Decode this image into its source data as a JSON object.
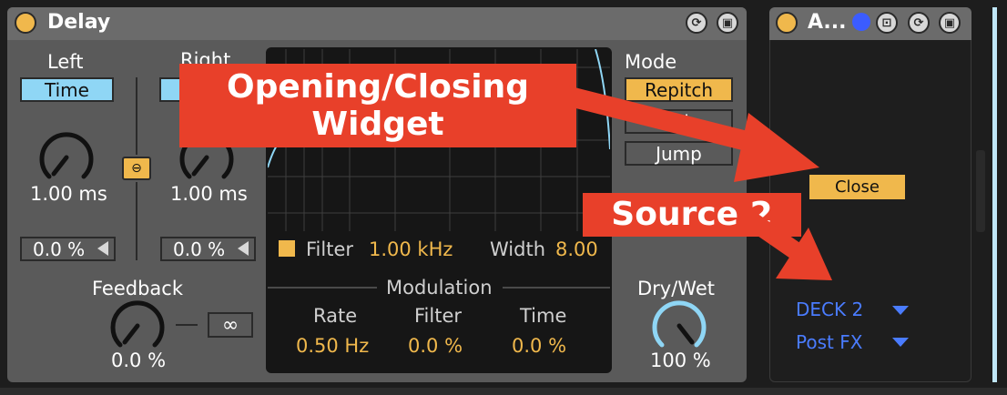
{
  "delay": {
    "title": "Delay",
    "left": {
      "heading": "Left",
      "mode": "Time",
      "knob_value": "1.00 ms",
      "offset": "0.0 %"
    },
    "right": {
      "heading": "Right",
      "knob_value": "1.00 ms",
      "offset": "0.0 %"
    },
    "feedback": {
      "label": "Feedback",
      "value": "0.0 %",
      "freeze_icon": "infinity-icon"
    },
    "filter": {
      "label": "Filter",
      "freq": "1.00 kHz",
      "width_label": "Width",
      "width_value": "8.00"
    },
    "modulation": {
      "heading": "Modulation",
      "rate_label": "Rate",
      "rate_value": "0.50 Hz",
      "filter_label": "Filter",
      "filter_value": "0.0 %",
      "time_label": "Time",
      "time_value": "0.0 %"
    },
    "mode": {
      "heading": "Mode",
      "options": [
        "Repitch",
        "Fade",
        "Jump"
      ],
      "selected": "Repitch"
    },
    "drywet": {
      "label": "Dry/Wet",
      "value": "100 %",
      "level": 1.0
    }
  },
  "device2": {
    "title": "A...",
    "close_label": "Close",
    "source": "DECK 2",
    "tap": "Post FX"
  },
  "annotations": {
    "opening": "Opening/Closing Widget",
    "source": "Source 2"
  },
  "colors": {
    "accent_yellow": "#f0b84c",
    "accent_blue": "#8fd6f5",
    "link_blue": "#4a7cff",
    "annotation_red": "#e8402a"
  }
}
